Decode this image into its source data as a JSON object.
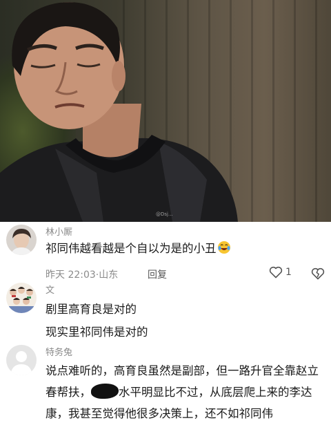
{
  "photo": {
    "watermark": "@Dsj..."
  },
  "comments": [
    {
      "username": "林小厮",
      "text": "祁同伟越看越是个自以为是的小丑",
      "emoji": "laughing-crying-emoji",
      "time": "昨天 22:03",
      "location": "山东",
      "meta_sep": "·",
      "reply_label": "回复",
      "like_count": "1"
    },
    {
      "username": "文",
      "lines": [
        "剧里高育良是对的",
        "现实里祁同伟是对的"
      ]
    },
    {
      "username": "特务兔",
      "text_before": "说点难听的，高育良虽然是副部，但一路升官全靠赵立春帮扶，",
      "text_after": "水平明显比不过，从底层爬上来的李达康，我甚至觉得他很多决策上，还不如祁同伟"
    }
  ]
}
